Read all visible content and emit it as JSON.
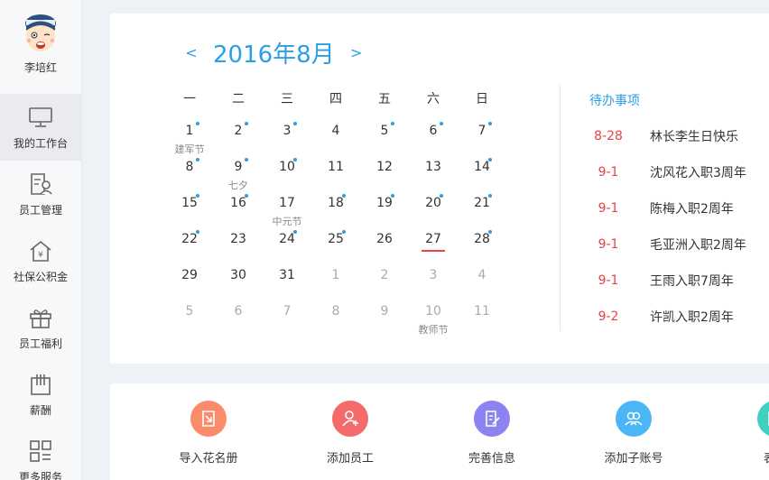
{
  "user": {
    "name": "李培红"
  },
  "sidebar": {
    "items": [
      {
        "label": "我的工作台",
        "icon": "monitor-icon",
        "active": true
      },
      {
        "label": "员工管理",
        "icon": "employee-file-icon"
      },
      {
        "label": "社保公积金",
        "icon": "house-yen-icon"
      },
      {
        "label": "员工福利",
        "icon": "gift-icon"
      },
      {
        "label": "薪酬",
        "icon": "payroll-book-icon"
      },
      {
        "label": "更多服务",
        "icon": "grid-more-icon"
      }
    ]
  },
  "calendar": {
    "title": "2016年8月",
    "prev": "<",
    "next": ">",
    "weekdays": [
      "一",
      "二",
      "三",
      "四",
      "五",
      "六",
      "日"
    ],
    "weeks": [
      [
        {
          "d": "1",
          "dot": true,
          "fest": "建军节"
        },
        {
          "d": "2",
          "dot": true
        },
        {
          "d": "3",
          "dot": true
        },
        {
          "d": "4"
        },
        {
          "d": "5",
          "dot": true
        },
        {
          "d": "6",
          "dot": true
        },
        {
          "d": "7",
          "dot": true
        }
      ],
      [
        {
          "d": "8",
          "dot": true
        },
        {
          "d": "9",
          "dot": true,
          "fest": "七夕"
        },
        {
          "d": "10",
          "dot": true
        },
        {
          "d": "11"
        },
        {
          "d": "12"
        },
        {
          "d": "13"
        },
        {
          "d": "14",
          "dot": true
        }
      ],
      [
        {
          "d": "15",
          "dot": true
        },
        {
          "d": "16",
          "dot": true
        },
        {
          "d": "17",
          "fest": "中元节"
        },
        {
          "d": "18",
          "dot": true
        },
        {
          "d": "19",
          "dot": true
        },
        {
          "d": "20",
          "dot": true
        },
        {
          "d": "21",
          "dot": true
        }
      ],
      [
        {
          "d": "22",
          "dot": true
        },
        {
          "d": "23"
        },
        {
          "d": "24",
          "dot": true
        },
        {
          "d": "25",
          "dot": true
        },
        {
          "d": "26"
        },
        {
          "d": "27",
          "today": true
        },
        {
          "d": "28",
          "dot": true
        }
      ],
      [
        {
          "d": "29"
        },
        {
          "d": "30"
        },
        {
          "d": "31"
        },
        {
          "d": "1",
          "other": true
        },
        {
          "d": "2",
          "other": true
        },
        {
          "d": "3",
          "other": true
        },
        {
          "d": "4",
          "other": true
        }
      ],
      [
        {
          "d": "5",
          "other": true
        },
        {
          "d": "6",
          "other": true
        },
        {
          "d": "7",
          "other": true
        },
        {
          "d": "8",
          "other": true
        },
        {
          "d": "9",
          "other": true
        },
        {
          "d": "10",
          "other": true,
          "fest": "教师节"
        },
        {
          "d": "11",
          "other": true
        }
      ]
    ]
  },
  "todo": {
    "title": "待办事项",
    "items": [
      {
        "date": "8-28",
        "text": "林长李生日快乐"
      },
      {
        "date": "9-1",
        "text": "沈风花入职3周年"
      },
      {
        "date": "9-1",
        "text": "陈梅入职2周年"
      },
      {
        "date": "9-1",
        "text": "毛亚洲入职2周年"
      },
      {
        "date": "9-1",
        "text": "王雨入职7周年"
      },
      {
        "date": "9-2",
        "text": "许凯入职2周年"
      }
    ]
  },
  "actions": [
    {
      "label": "导入花名册",
      "color": "#fb8c6b",
      "icon": "import-icon"
    },
    {
      "label": "添加员工",
      "color": "#f56a6a",
      "icon": "add-user-icon"
    },
    {
      "label": "完善信息",
      "color": "#8b84f0",
      "icon": "edit-form-icon"
    },
    {
      "label": "添加子账号",
      "color": "#4ab6f5",
      "icon": "sub-account-icon"
    },
    {
      "label": "表单",
      "color": "#3ed1c2",
      "icon": "form-icon"
    }
  ],
  "colors": {
    "accent": "#2b9ee6",
    "danger": "#e54545"
  }
}
